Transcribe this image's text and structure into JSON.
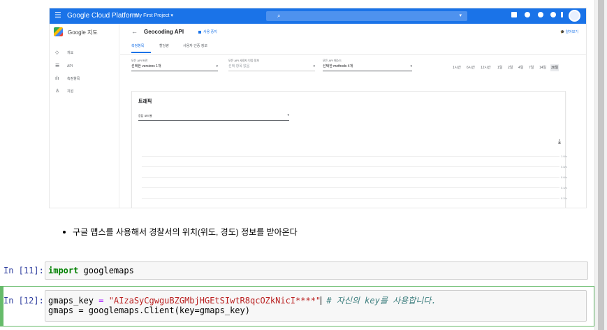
{
  "gcp": {
    "brand": "Google Cloud Platform",
    "project": "My First Project",
    "sidebar_title": "Google 지도",
    "sidebar_items": [
      {
        "icon": "◇",
        "label": "개요"
      },
      {
        "icon": "☰",
        "label": "API"
      },
      {
        "icon": "ılı",
        "label": "측정항목"
      },
      {
        "icon": "♙",
        "label": "지원"
      }
    ],
    "page_title": "Geocoding API",
    "status": "사용 중지",
    "learn_more": "알아보기",
    "tabs": [
      "측정항목",
      "할당량",
      "사용자 인증 정보"
    ],
    "filters": [
      {
        "label": "모든 API 버전",
        "value": "선택한 versions 1개"
      },
      {
        "label": "모든 API 사용자 인증 정보",
        "value": "선택 항목 없음"
      },
      {
        "label": "모든 API 메소드",
        "value": "선택한 methods 4개"
      }
    ],
    "time_ranges": [
      "1시간",
      "6시간",
      "12시간",
      "1일",
      "2일",
      "4일",
      "7일",
      "14일",
      "30일"
    ],
    "selected_time_range": "30일",
    "traffic_title": "트래픽",
    "traffic_select": "응답 코드별",
    "y_ticks": [
      "1.0/s",
      "0.8/s",
      "0.6/s",
      "0.4/s",
      "0.2/s"
    ]
  },
  "notebook": {
    "bullet": "구글 맵스를 사용해서 경찰서의 위치(위도, 경도) 정보를 받아온다",
    "cell11": {
      "prompt": "In [11]:",
      "keyword": "import",
      "module": " googlemaps"
    },
    "cell12": {
      "prompt": "In [12]:",
      "line1_var": "gmaps_key ",
      "line1_op": "=",
      "line1_str": " \"AIzaSyCgwguBZGMbjHGEtSIwtR8qcOZkNicI****\"",
      "line1_comment": " # 자신의 key를 사용합니다.",
      "line2": "gmaps = googlemaps.Client(key=gmaps_key)"
    }
  }
}
